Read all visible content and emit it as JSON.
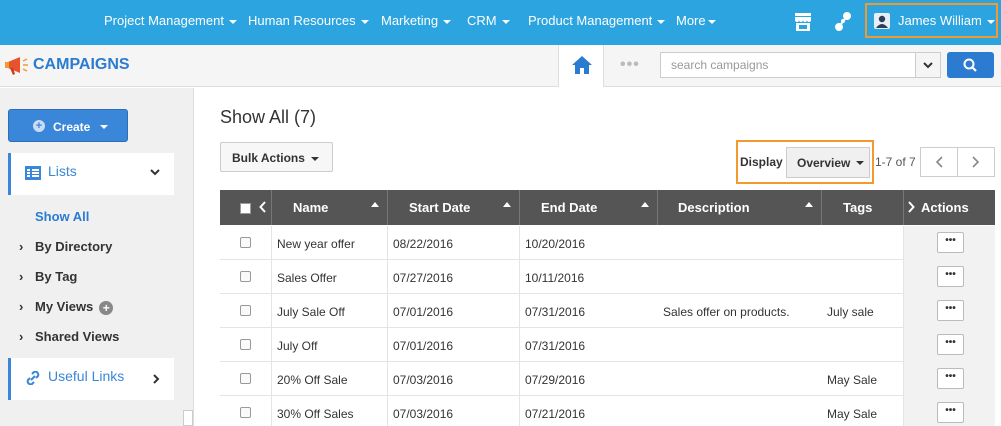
{
  "topnav": {
    "items": [
      {
        "label": "Project Management"
      },
      {
        "label": "Human Resources"
      },
      {
        "label": "Marketing"
      },
      {
        "label": "CRM"
      },
      {
        "label": "Product Management"
      },
      {
        "label": "More"
      }
    ],
    "user_name": "James William",
    "icons": [
      "store-icon",
      "apps-icon",
      "user-avatar-icon"
    ]
  },
  "header": {
    "module_title": "CAMPAIGNS",
    "search_placeholder": "search campaigns",
    "dots": "•••"
  },
  "sidebar": {
    "create_label": "Create",
    "lists_label": "Lists",
    "active_item": "Show All",
    "items": [
      {
        "label": "By Directory"
      },
      {
        "label": "By Tag"
      },
      {
        "label": "My Views"
      },
      {
        "label": "Shared Views"
      }
    ],
    "useful_links_label": "Useful Links"
  },
  "main": {
    "title": "Show All (7)",
    "bulk_actions_label": "Bulk Actions",
    "display_label": "Display",
    "display_value": "Overview",
    "paging_text": "1-7 of 7"
  },
  "table": {
    "columns": [
      "Name",
      "Start Date",
      "End Date",
      "Description",
      "Tags",
      "Actions"
    ],
    "action_label": "•••",
    "rows": [
      {
        "name": "New year offer",
        "start": "08/22/2016",
        "end": "10/20/2016",
        "description": "",
        "tags": ""
      },
      {
        "name": "Sales Offer",
        "start": "07/27/2016",
        "end": "10/11/2016",
        "description": "",
        "tags": ""
      },
      {
        "name": "July Sale Off",
        "start": "07/01/2016",
        "end": "07/31/2016",
        "description": "Sales offer on products.",
        "tags": "July sale"
      },
      {
        "name": "July Off",
        "start": "07/01/2016",
        "end": "07/31/2016",
        "description": "",
        "tags": ""
      },
      {
        "name": "20% Off Sale",
        "start": "07/03/2016",
        "end": "07/29/2016",
        "description": "",
        "tags": "May Sale"
      },
      {
        "name": "30% Off Sales",
        "start": "07/03/2016",
        "end": "07/21/2016",
        "description": "",
        "tags": "May Sale"
      }
    ]
  },
  "colors": {
    "topnav_bg": "#2ba4e0",
    "accent": "#2b7bd0",
    "highlight": "#f29a2e",
    "table_header": "#555555"
  }
}
